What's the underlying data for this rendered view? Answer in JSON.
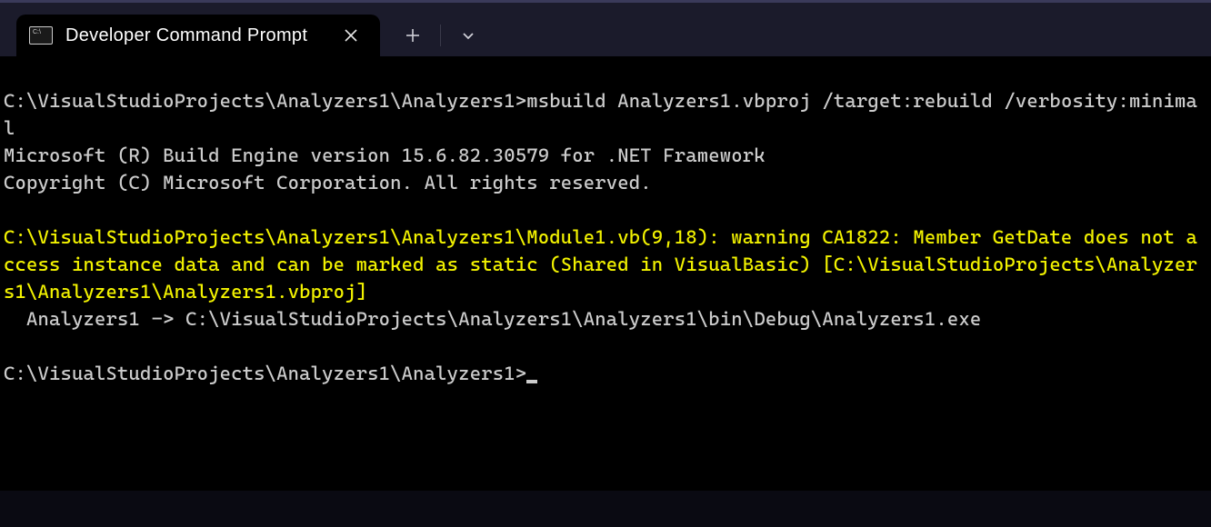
{
  "tab": {
    "title": "Developer Command Prompt"
  },
  "terminal": {
    "prompt1_path": "C:\\VisualStudioProjects\\Analyzers1\\Analyzers1>",
    "command": "msbuild Analyzers1.vbproj /target:rebuild /verbosity:minimal",
    "engine_line": "Microsoft (R) Build Engine version 15.6.82.30579 for .NET Framework",
    "copyright_line": "Copyright (C) Microsoft Corporation. All rights reserved.",
    "warning_text": "C:\\VisualStudioProjects\\Analyzers1\\Analyzers1\\Module1.vb(9,18): warning CA1822: Member GetDate does not access instance data and can be marked as static (Shared in VisualBasic) [C:\\VisualStudioProjects\\Analyzers1\\Analyzers1\\Analyzers1.vbproj]",
    "output_line": "  Analyzers1 -> C:\\VisualStudioProjects\\Analyzers1\\Analyzers1\\bin\\Debug\\Analyzers1.exe",
    "prompt2_path": "C:\\VisualStudioProjects\\Analyzers1\\Analyzers1>"
  }
}
